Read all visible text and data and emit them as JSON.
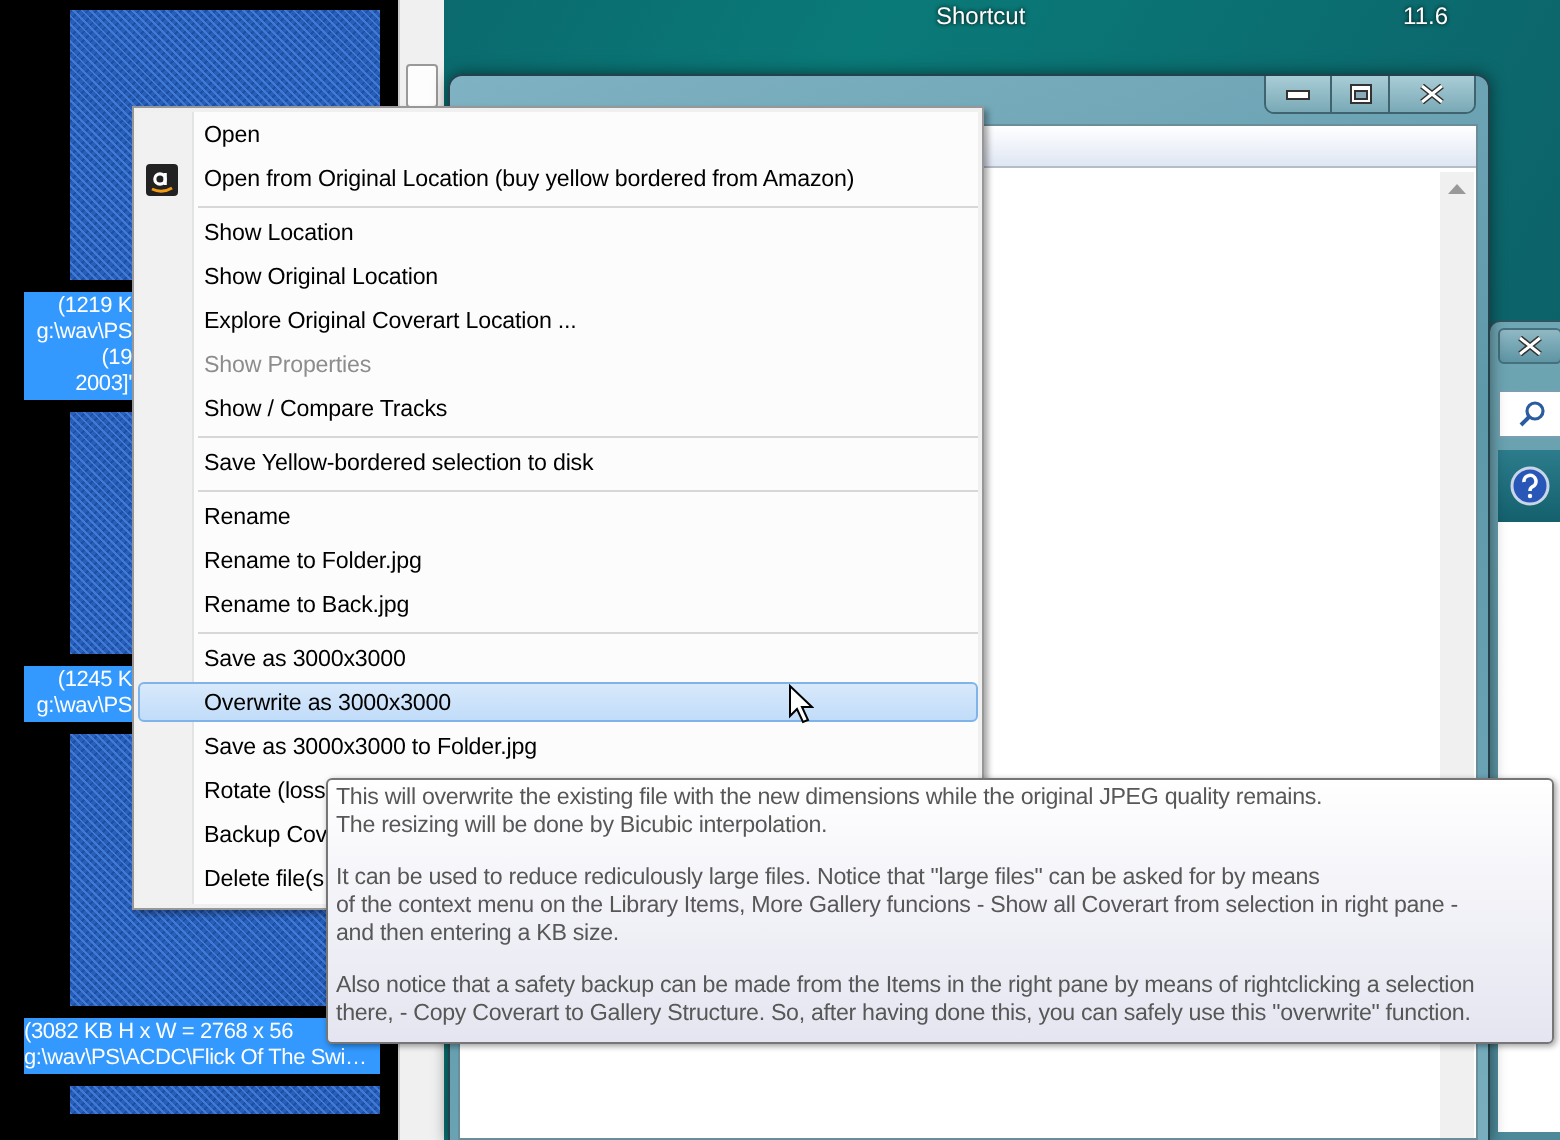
{
  "desktop": {
    "texts": [
      "Shortcut",
      "11.6"
    ]
  },
  "gallery": {
    "items": [
      {
        "selected": true,
        "caption_lines": [
          "(1219 K",
          "g:\\wav\\PS",
          "(19",
          "2003]'"
        ]
      },
      {
        "selected": true,
        "caption_lines": [
          "(1245 K",
          "g:\\wav\\PS"
        ]
      },
      {
        "selected": true,
        "caption_lines": [
          "(3082 KB H x W = 2768 x 56",
          "g:\\wav\\PS\\ACDC\\Flick Of The Swi…"
        ]
      },
      {
        "selected": true
      }
    ]
  },
  "context_menu": {
    "groups": [
      [
        {
          "label": "Open",
          "kind": "plain",
          "disabled": false,
          "selected": false
        },
        {
          "label": "Open from Original Location (buy yellow bordered from Amazon)",
          "kind": "amazon",
          "disabled": false,
          "selected": false
        }
      ],
      [
        {
          "label": "Show Location",
          "kind": "plain",
          "disabled": false,
          "selected": false
        },
        {
          "label": "Show Original Location",
          "kind": "plain",
          "disabled": false,
          "selected": false
        },
        {
          "label": "Explore Original Coverart Location ...",
          "kind": "plain",
          "disabled": false,
          "selected": false
        },
        {
          "label": "Show Properties",
          "kind": "plain",
          "disabled": true,
          "selected": false
        },
        {
          "label": "Show / Compare Tracks",
          "kind": "plain",
          "disabled": false,
          "selected": false
        }
      ],
      [
        {
          "label": "Save Yellow-bordered selection to disk",
          "kind": "plain",
          "disabled": false,
          "selected": false
        }
      ],
      [
        {
          "label": "Rename",
          "kind": "plain",
          "disabled": false,
          "selected": false
        },
        {
          "label": "Rename to Folder.jpg",
          "kind": "plain",
          "disabled": false,
          "selected": false
        },
        {
          "label": "Rename to Back.jpg",
          "kind": "plain",
          "disabled": false,
          "selected": false
        }
      ],
      [
        {
          "label": "Save as 3000x3000",
          "kind": "plain",
          "disabled": false,
          "selected": false
        },
        {
          "label": "Overwrite as 3000x3000",
          "kind": "plain",
          "disabled": false,
          "selected": true
        },
        {
          "label": "Save as 3000x3000 to Folder.jpg",
          "kind": "plain",
          "disabled": false,
          "selected": false
        },
        {
          "label": "Rotate (loss",
          "kind": "plain",
          "disabled": false,
          "selected": false
        },
        {
          "label": "Backup Cov",
          "kind": "plain",
          "disabled": false,
          "selected": false
        },
        {
          "label": "Delete file(s",
          "kind": "plain",
          "disabled": false,
          "selected": false
        }
      ]
    ]
  },
  "tooltip": {
    "paragraphs": [
      [
        "This will overwrite the existing file with the new dimensions while the original JPEG quality remains.",
        "The resizing will be done by Bicubic interpolation."
      ],
      [
        "It can be used to reduce rediculously large files. Notice that \"large files\" can be asked for by means",
        "of the context menu on the Library Items, More Gallery funcions - Show all Coverart from selection in right pane -",
        "and then entering a KB size."
      ],
      [
        "Also notice that a safety backup can be made from the Items in the right pane by means of rightclicking a selection",
        "there, - Copy Coverart to Gallery Structure. So, after having done this, you can safely use this \"overwrite\" function."
      ]
    ]
  }
}
